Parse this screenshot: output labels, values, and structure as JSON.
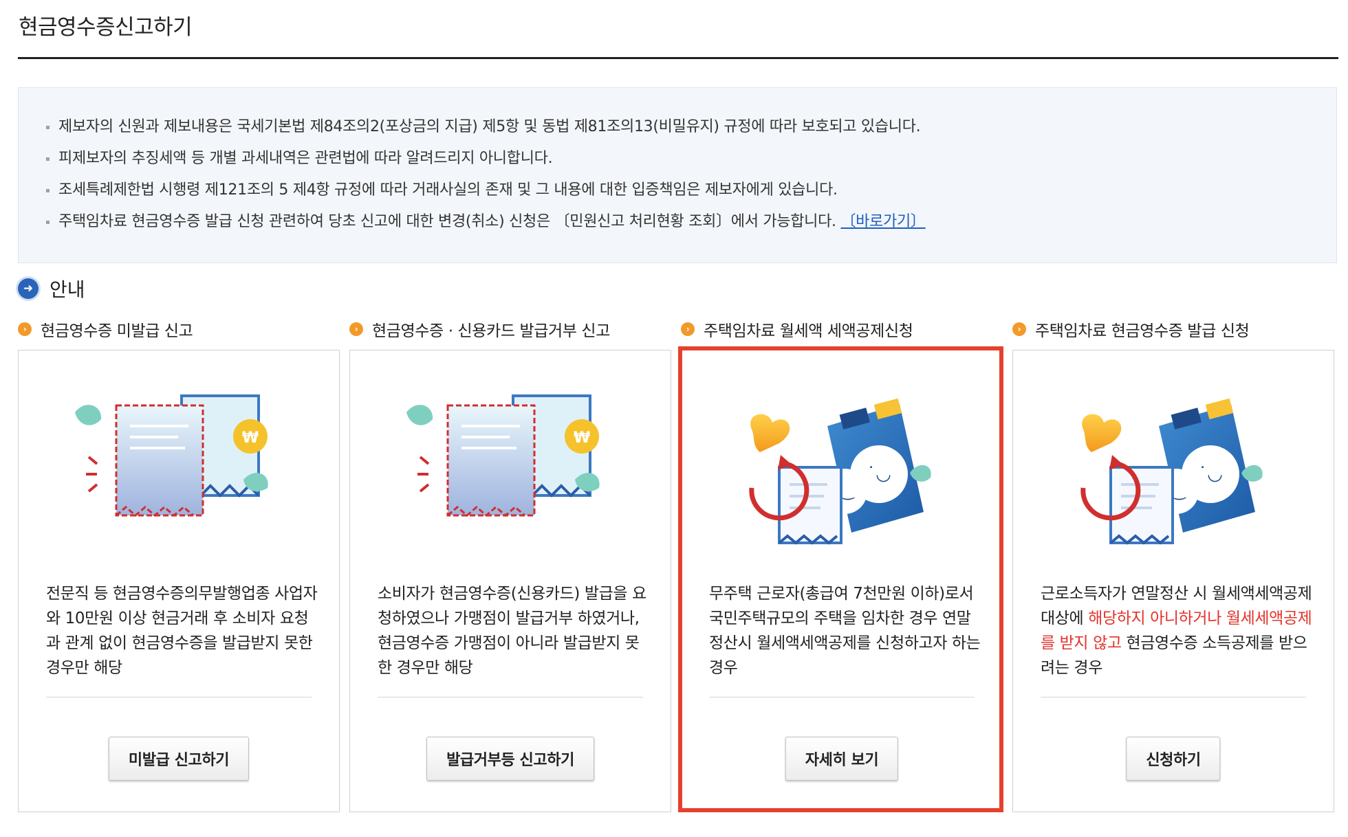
{
  "page": {
    "title": "현금영수증신고하기"
  },
  "notice": {
    "items": [
      "제보자의 신원과 제보내용은 국세기본법 제84조의2(포상금의 지급) 제5항 및 동법 제81조의13(비밀유지) 규정에 따라 보호되고 있습니다.",
      "피제보자의 추징세액 등 개별 과세내역은 관련법에 따라 알려드리지 아니합니다.",
      "조세특례제한법 시행령 제121조의 5 제4항 규정에 따라 거래사실의 존재 및 그 내용에 대한 입증책임은 제보자에게 있습니다.",
      "주택임차료 현금영수증 발급 신청 관련하여 당초 신고에 대한 변경(취소) 신청은 〔민원신고 처리현황 조회〕에서 가능합니다."
    ],
    "link_label": "〔바로가기〕"
  },
  "guide": {
    "label": "안내"
  },
  "cards": [
    {
      "title": "현금영수증 미발급 신고",
      "desc": "전문직 등 현금영수증의무발행업종 사업자와 10만원 이상 현금거래 후 소비자 요청과 관계 없이 현금영수증을 발급받지 못한 경우만 해당",
      "button": "미발급 신고하기"
    },
    {
      "title": "현금영수증 · 신용카드 발급거부 신고",
      "desc": "소비자가 현금영수증(신용카드) 발급을 요청하였으나 가맹점이 발급거부 하였거나, 현금영수증 가맹점이 아니라 발급받지 못한 경우만 해당",
      "button": "발급거부등 신고하기"
    },
    {
      "title": "주택임차료 월세액 세액공제신청",
      "desc": "무주택 근로자(총급여 7천만원 이하)로서 국민주택규모의 주택을 임차한 경우 연말정산시 월세액세액공제를 신청하고자 하는 경우",
      "button": "자세히 보기"
    },
    {
      "title": "주택임차료 현금영수증 발급 신청",
      "desc_a": "근로소득자가 연말정산 시 월세액세액공제 대상에 ",
      "desc_red": "해당하지 아니하거나 월세세액공제를 받지 않고",
      "desc_b": " 현금영수증 소득공제를 받으려는 경우",
      "button": "신청하기"
    }
  ],
  "icons": {
    "guide": "arrow-right-circle-icon",
    "card_title": "chevron-right-circle-icon"
  },
  "colors": {
    "accent_blue": "#2a64b8",
    "highlight_red": "#e5412e",
    "emphasis_red": "#e3342a",
    "title_dot_orange": "#f19a2a"
  }
}
